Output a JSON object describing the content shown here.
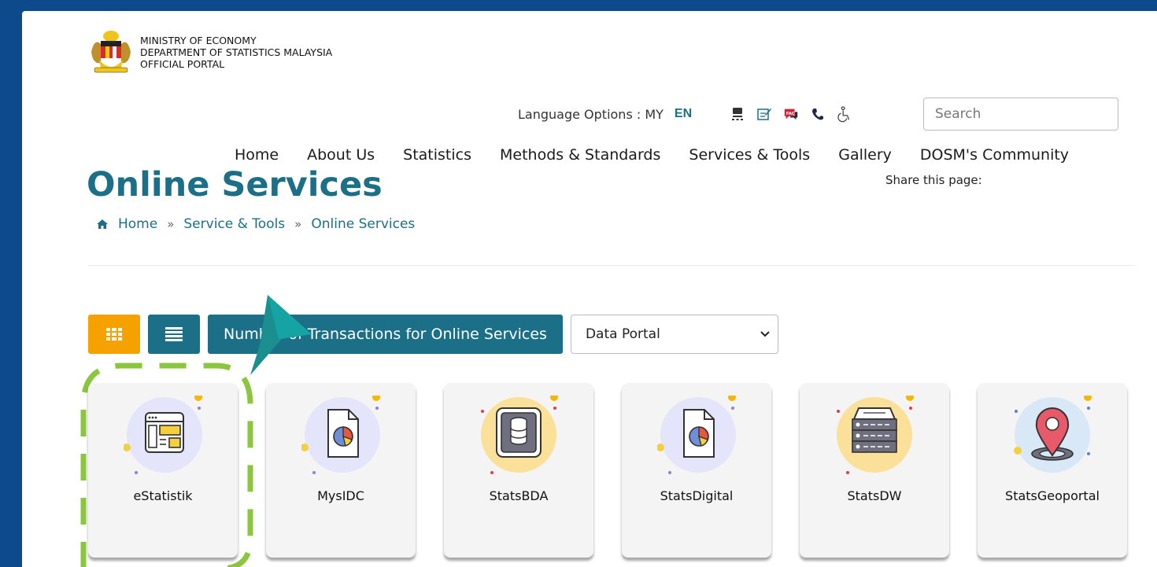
{
  "header": {
    "ministry_line1": "MINISTRY OF ECONOMY",
    "ministry_line2": "DEPARTMENT OF STATISTICS MALAYSIA",
    "ministry_line3": "OFFICIAL PORTAL"
  },
  "utility": {
    "language_label": "Language Options : MY",
    "language_en": "EN",
    "icons": [
      "sitemap-icon",
      "feedback-icon",
      "faq-icon",
      "phone-icon",
      "accessibility-icon"
    ],
    "search_placeholder": "Search"
  },
  "nav": {
    "items": [
      "Home",
      "About Us",
      "Statistics",
      "Methods & Standards",
      "Services & Tools",
      "Gallery",
      "DOSM's Community"
    ]
  },
  "share_label": "Share this page:",
  "page_title": "Online Services",
  "breadcrumb": {
    "home": "Home",
    "level2": "Service & Tools",
    "level3": "Online Services",
    "separator": "»"
  },
  "toolbar": {
    "transactions_label": "Number of Transactions for Online Services",
    "select_value": "Data Portal"
  },
  "cards": [
    {
      "label": "eStatistik",
      "icon": "web-window-icon"
    },
    {
      "label": "MysIDC",
      "icon": "document-chart-icon"
    },
    {
      "label": "StatsBDA",
      "icon": "database-icon"
    },
    {
      "label": "StatsDigital",
      "icon": "document-chart-icon"
    },
    {
      "label": "StatsDW",
      "icon": "server-icon"
    },
    {
      "label": "StatsGeoportal",
      "icon": "location-pin-icon"
    }
  ],
  "colors": {
    "frame": "#0c4a8c",
    "accent": "#1b6f86",
    "grid_button": "#f5a200",
    "highlight": "#8cc63f"
  }
}
